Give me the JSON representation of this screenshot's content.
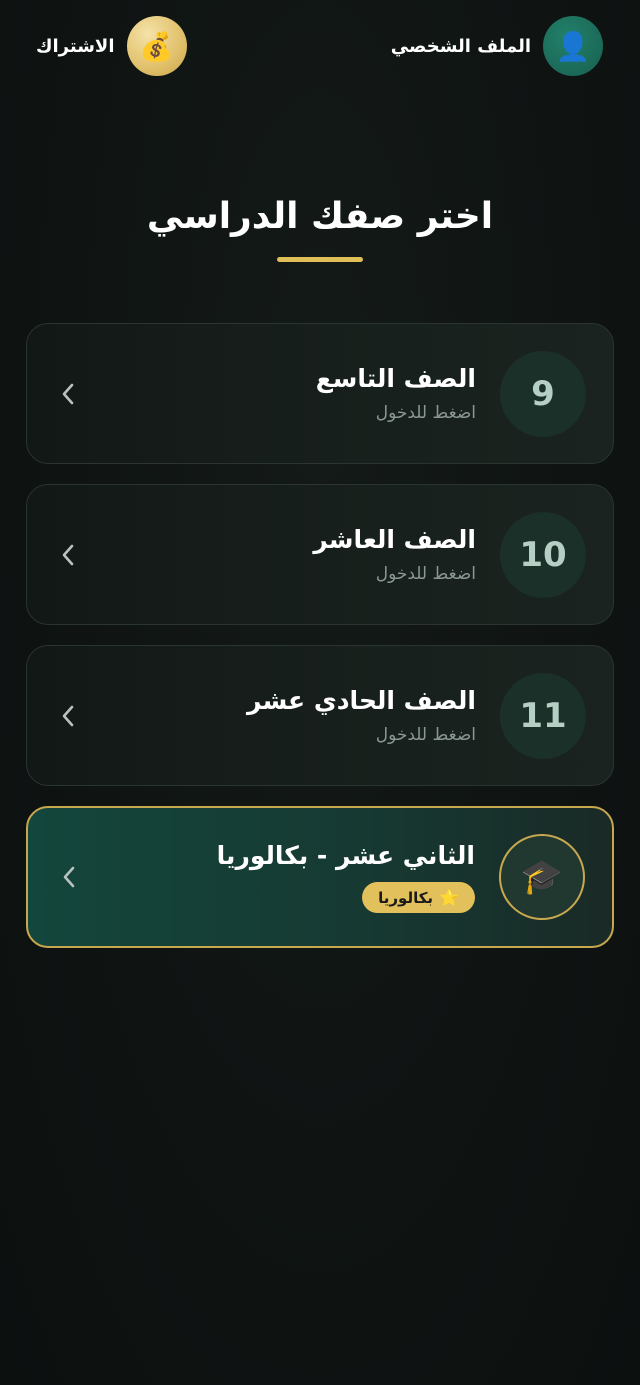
{
  "header": {
    "profile_label": "الملف الشخصي",
    "profile_icon": "👤",
    "subscription_label": "الاشتراك",
    "subscription_icon": "💰"
  },
  "title": "اختر صفك الدراسي",
  "grades": [
    {
      "number": "9",
      "title": "الصف التاسع",
      "subtitle": "اضغط للدخول"
    },
    {
      "number": "10",
      "title": "الصف العاشر",
      "subtitle": "اضغط للدخول"
    },
    {
      "number": "11",
      "title": "الصف الحادي عشر",
      "subtitle": "اضغط للدخول"
    }
  ],
  "featured": {
    "icon": "🎓",
    "title": "الثاني عشر - بكالوريا",
    "badge_star": "⭐",
    "badge_label": "بكالوريا"
  },
  "colors": {
    "accent_gold": "#e0bf58",
    "featured_green": "#13463c",
    "background": "#0f1413"
  }
}
